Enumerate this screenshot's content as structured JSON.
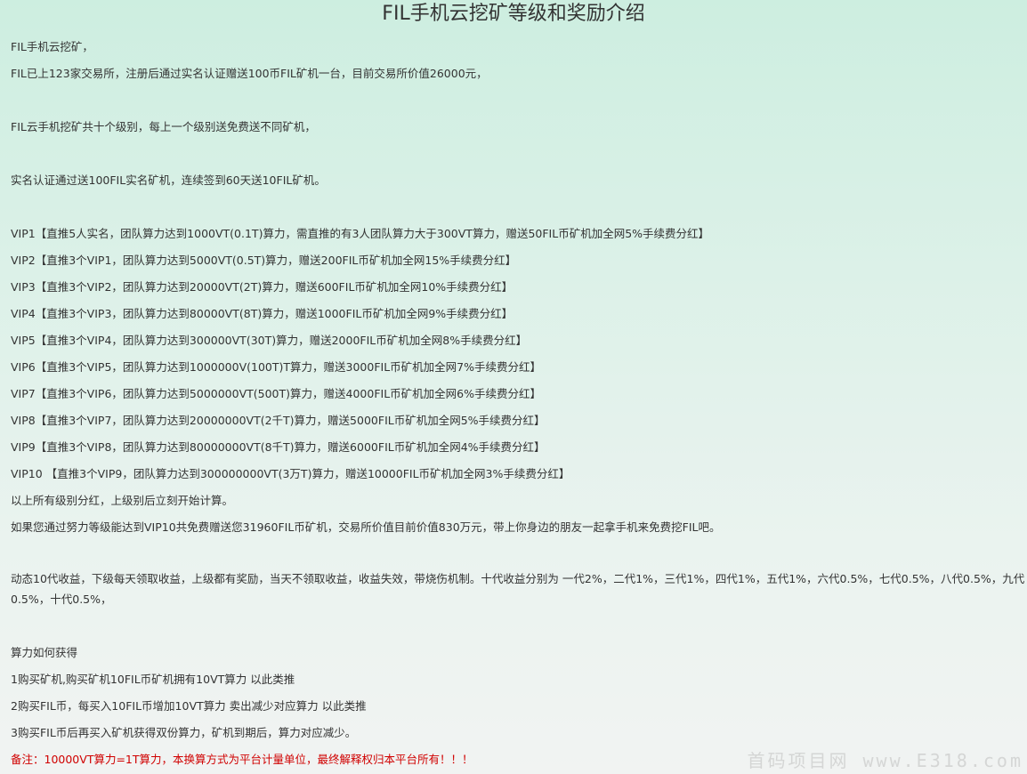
{
  "title": "FIL手机云挖矿等级和奖励介绍",
  "intro": [
    "FIL手机云挖矿，",
    "FIL已上123家交易所，注册后通过实名认证赠送100币FIL矿机一台，目前交易所价值26000元，"
  ],
  "levels_intro": "FIL云手机挖矿共十个级别，每上一个级别送免费送不同矿机，",
  "signin": "实名认证通过送100FIL实名矿机，连续签到60天送10FIL矿机。",
  "vip_levels": [
    "VIP1【直推5人实名，团队算力达到1000VT(0.1T)算力，需直推的有3人团队算力大于300VT算力，赠送50FIL币矿机加全网5%手续费分红】",
    "VIP2【直推3个VIP1，团队算力达到5000VT(0.5T)算力，赠送200FIL币矿机加全网15%手续费分红】",
    "VIP3【直推3个VIP2，团队算力达到20000VT(2T)算力，赠送600FIL币矿机加全网10%手续费分红】",
    "VIP4【直推3个VIP3，团队算力达到80000VT(8T)算力，赠送1000FIL币矿机加全网9%手续费分红】",
    "VIP5【直推3个VIP4，团队算力达到300000VT(30T)算力，赠送2000FIL币矿机加全网8%手续费分红】",
    "VIP6【直推3个VIP5，团队算力达到1000000V(100T)T算力，赠送3000FIL币矿机加全网7%手续费分红】",
    "VIP7【直推3个VIP6，团队算力达到5000000VT(500T)算力，赠送4000FIL币矿机加全网6%手续费分红】",
    "VIP8【直推3个VIP7，团队算力达到20000000VT(2千T)算力，赠送5000FIL币矿机加全网5%手续费分红】",
    "VIP9【直推3个VIP8，团队算力达到80000000VT(8千T)算力，赠送6000FIL币矿机加全网4%手续费分红】",
    "VIP10 【直推3个VIP9，团队算力达到300000000VT(3万T)算力，赠送10000FIL币矿机加全网3%手续费分红】"
  ],
  "summary": [
    "以上所有级别分红，上级别后立刻开始计算。",
    "如果您通过努力等级能达到VIP10共免费赠送您31960FIL币矿机，交易所价值目前价值830万元，带上你身边的朋友一起拿手机来免费挖FIL吧。"
  ],
  "dynamic": "动态10代收益，下级每天领取收益，上级都有奖励，当天不领取收益，收益失效，带烧伤机制。十代收益分别为 一代2%，二代1%，三代1%，四代1%，五代1%，六代0.5%，七代0.5%，八代0.5%，九代0.5%，十代0.5%，",
  "hashrate": {
    "heading": "算力如何获得",
    "items": [
      "1购买矿机,购买矿机10FIL币矿机拥有10VT算力 以此类推",
      "2购买FIL币，每买入10FIL币增加10VT算力 卖出减少对应算力 以此类推",
      "3购买FIL币后再买入矿机获得双份算力，矿机到期后，算力对应减少。"
    ]
  },
  "note": "备注：10000VT算力=1T算力，本换算方式为平台计量单位，最终解释权归本平台所有！！！",
  "watermark": "首码项目网 www.E318.com",
  "colors": {
    "text": "#333333",
    "note": "#d00000",
    "background_top": "#cdeee0",
    "background_bottom": "#f1f3f2"
  }
}
